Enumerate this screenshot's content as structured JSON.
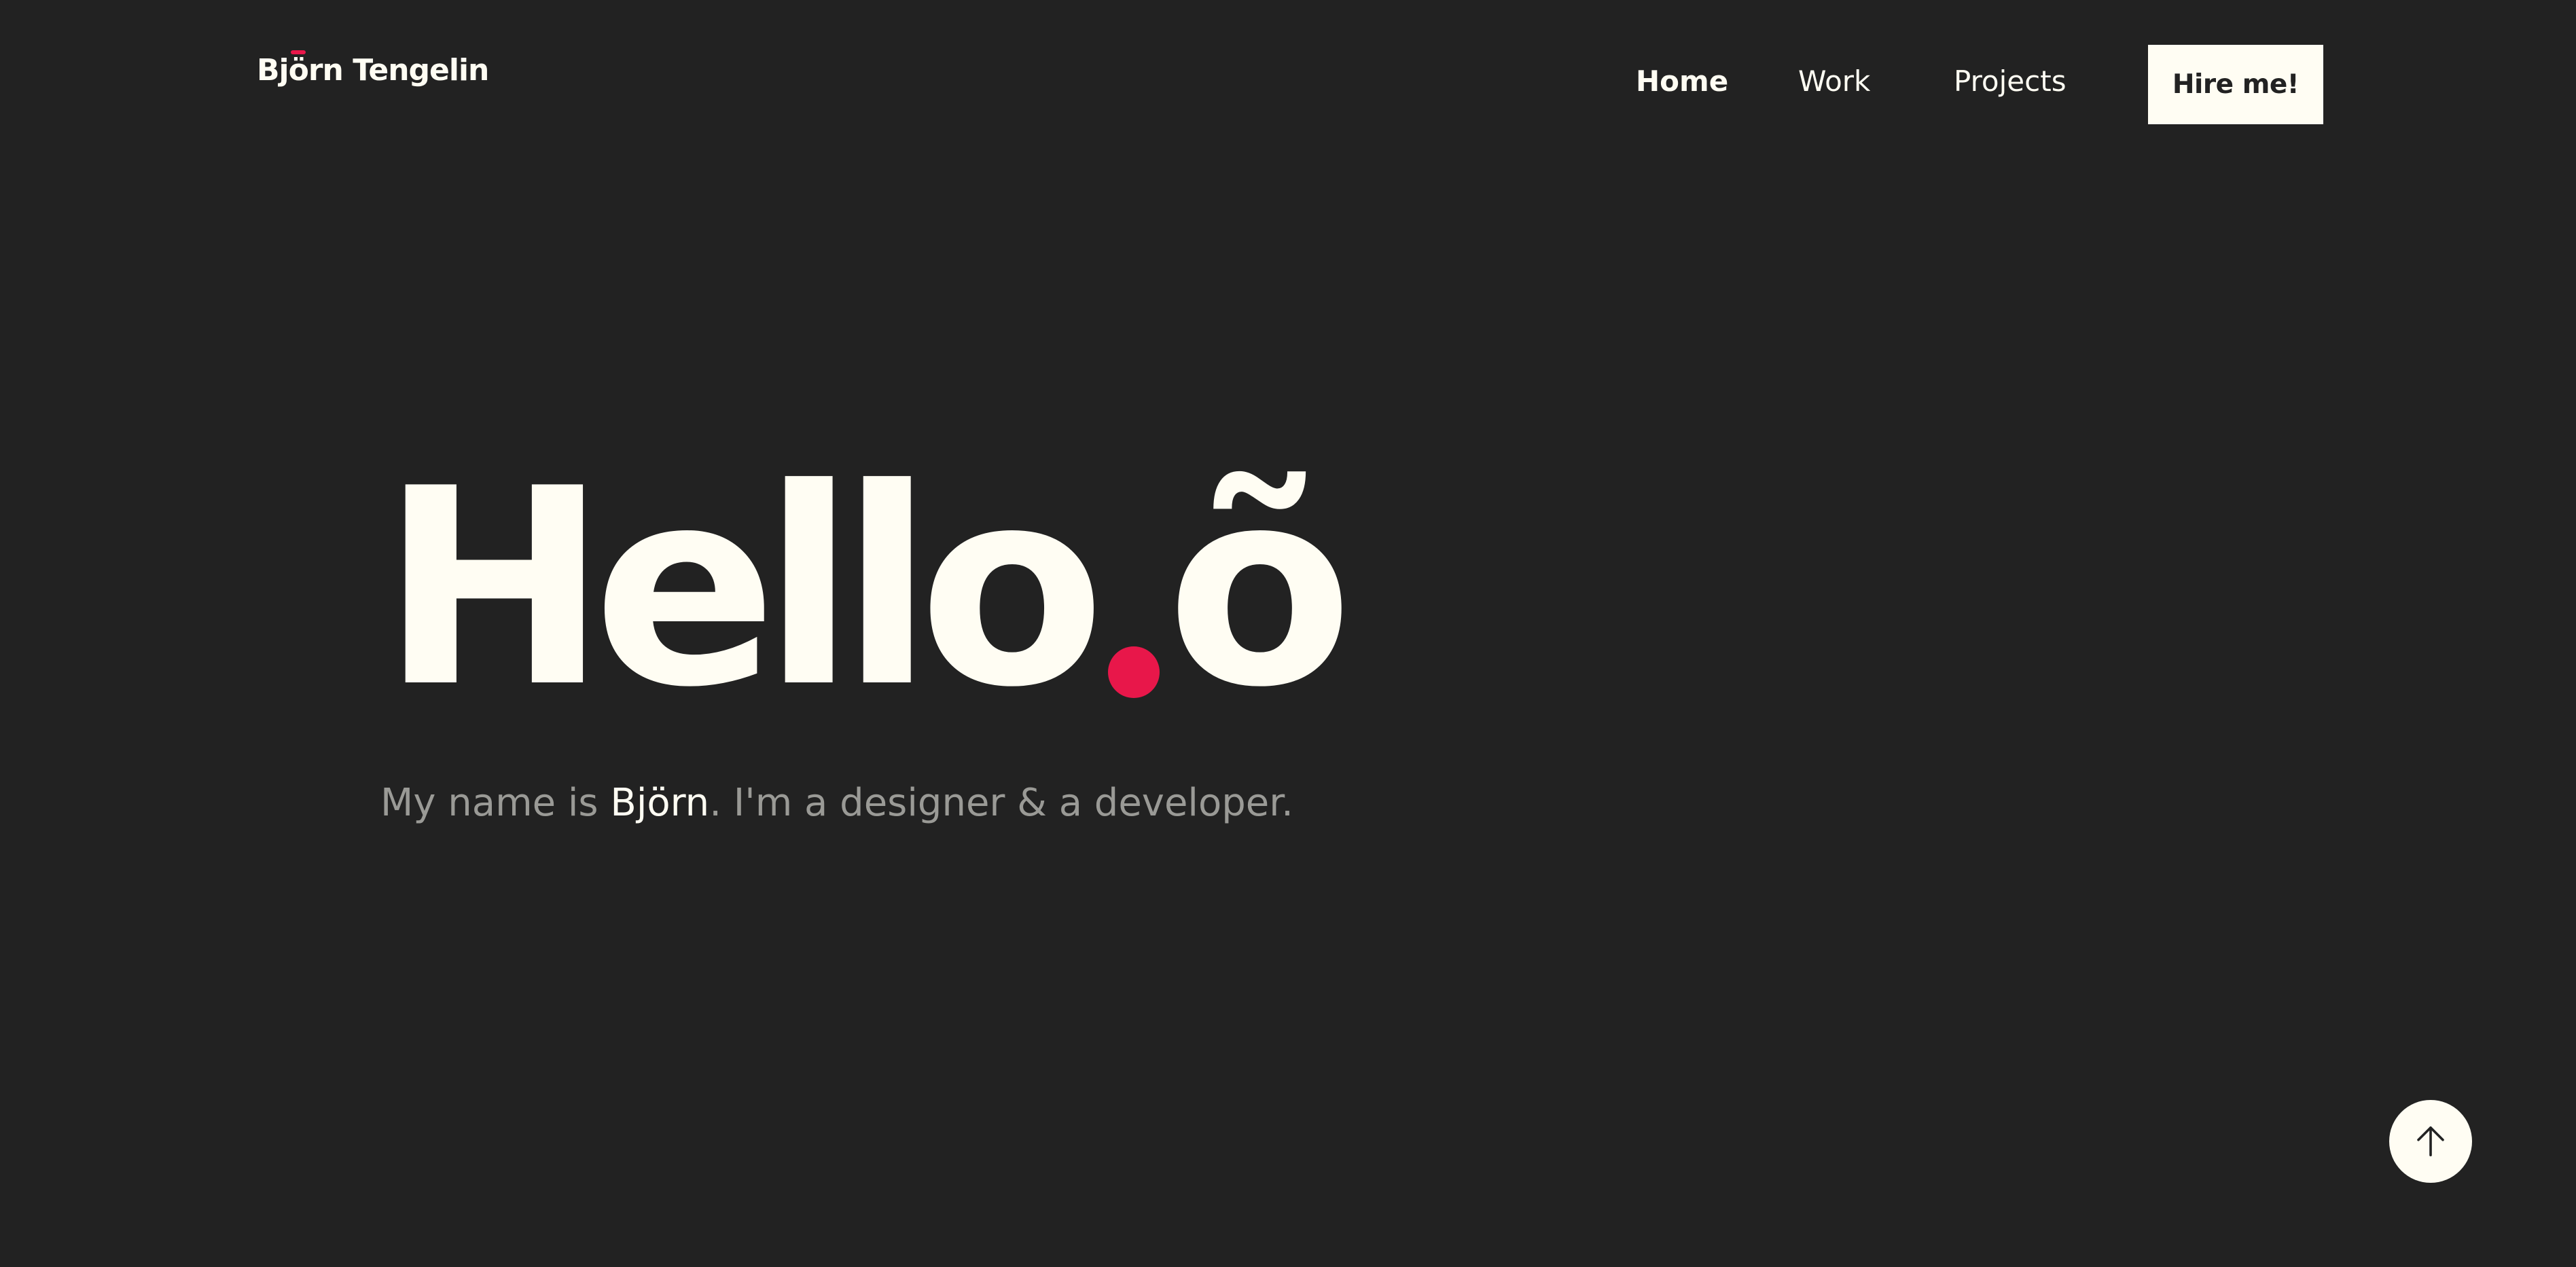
{
  "colors": {
    "background": "#222222",
    "text": "#fffdf3",
    "muted_text": "#9a9a96",
    "accent": "#e8174a"
  },
  "header": {
    "logo_part1": "Bj",
    "logo_accent_letter": "ö",
    "logo_part2": "rn Tengelin",
    "nav": {
      "home": "Home",
      "work": "Work",
      "projects": "Projects"
    },
    "hire_button": "Hire me!"
  },
  "hero": {
    "title_main": "Hello",
    "title_suffix": "õ",
    "intro_prefix": "My name is ",
    "intro_name": "Björn",
    "intro_suffix": ". I'm a designer & a developer."
  },
  "scroll_top": {
    "icon": "arrow-up-icon"
  }
}
